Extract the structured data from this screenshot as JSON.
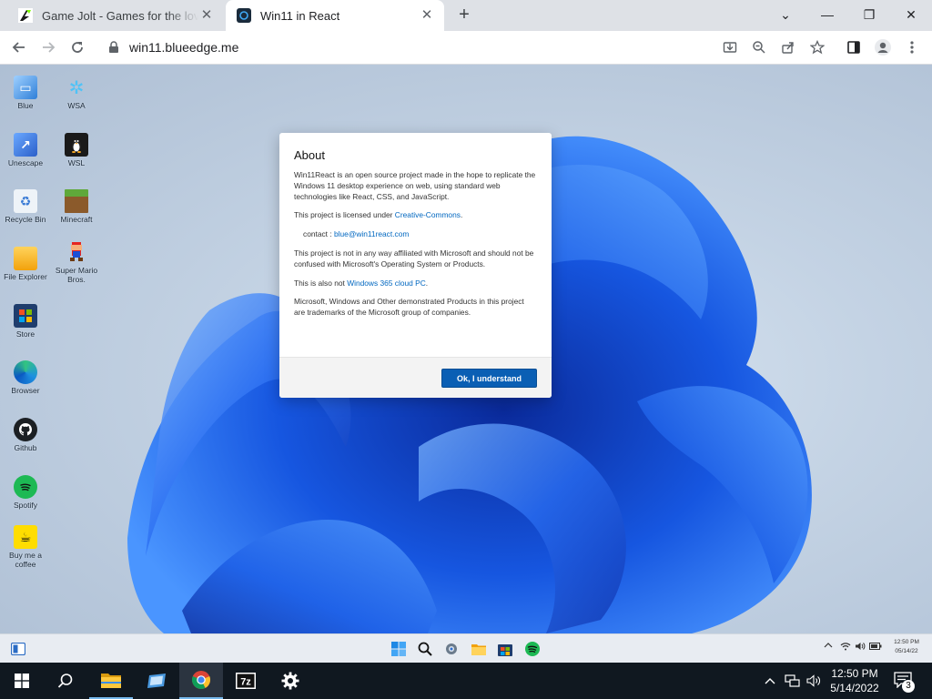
{
  "browser": {
    "tabs": [
      {
        "title": "Game Jolt - Games for the love of",
        "active": false
      },
      {
        "title": "Win11 in React",
        "active": true
      }
    ],
    "new_tab_label": "+",
    "url": "win11.blueedge.me",
    "window_controls": {
      "chevron": "⌄",
      "minimize": "—",
      "restore": "❐",
      "close": "✕"
    }
  },
  "desktop": {
    "icons": [
      {
        "label": "Blue",
        "icon": "blue-monitor-icon"
      },
      {
        "label": "WSA",
        "icon": "wsa-icon"
      },
      {
        "label": "Unescape",
        "icon": "unescape-icon"
      },
      {
        "label": "WSL",
        "icon": "linux-penguin-icon"
      },
      {
        "label": "Recycle Bin",
        "icon": "recycle-bin-icon"
      },
      {
        "label": "Minecraft",
        "icon": "minecraft-icon"
      },
      {
        "label": "File Explorer",
        "icon": "folder-icon"
      },
      {
        "label": "Super Mario Bros.",
        "icon": "mario-icon"
      },
      {
        "label": "Store",
        "icon": "store-icon"
      },
      {
        "label": "Browser",
        "icon": "edge-icon"
      },
      {
        "label": "Github",
        "icon": "github-icon"
      },
      {
        "label": "Spotify",
        "icon": "spotify-icon"
      },
      {
        "label": "Buy me a coffee",
        "icon": "coffee-icon"
      }
    ]
  },
  "about": {
    "title": "About",
    "p1": "Win11React is an open source project made in the hope to replicate the Windows 11 desktop experience on web, using standard web technologies like React, CSS, and JavaScript.",
    "license_prefix": "This project is licensed under ",
    "license_link": "Creative-Commons",
    "license_suffix": ".",
    "contact_prefix": "contact : ",
    "contact_email": "blue@win11react.com",
    "p3": "This project is not in any way affiliated with Microsoft and should not be confused with Microsoft's Operating System or Products.",
    "also_prefix": "This is also not ",
    "also_link": "Windows 365 cloud PC",
    "also_suffix": ".",
    "p5": "Microsoft, Windows and Other demonstrated Products in this project are trademarks of the Microsoft group of companies.",
    "ok_button": "Ok, I understand"
  },
  "win11_taskbar": {
    "clock_time": "12:50 PM",
    "clock_date": "05/14/22"
  },
  "host_taskbar": {
    "time": "12:50 PM",
    "date": "5/14/2022",
    "notification_count": "3",
    "apps": [
      "file-explorer",
      "remote-desktop",
      "chrome",
      "7zip",
      "settings"
    ]
  },
  "colors": {
    "accent": "#0067c0",
    "ok_button_bg": "#0a5fb4",
    "host_taskbar_bg": "#101820",
    "active_indicator": "#76b9ed"
  }
}
